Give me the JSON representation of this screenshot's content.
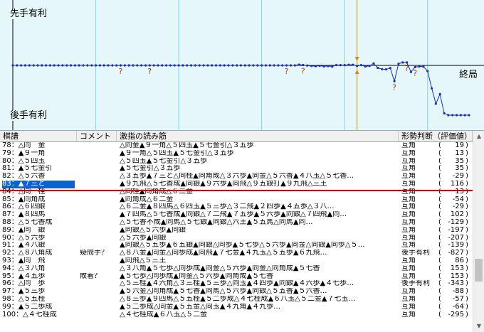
{
  "graph": {
    "top_label": "先手有利",
    "bottom_label": "後手有利",
    "end_label": "終局",
    "current_move": 83,
    "question_moves": [
      26,
      33,
      66,
      70,
      92,
      95,
      97
    ],
    "evaluations": [
      0,
      0,
      0,
      0,
      0,
      0,
      0,
      0,
      0,
      0,
      0,
      0,
      0,
      0,
      0,
      0,
      0,
      0,
      0,
      0,
      0,
      0,
      0,
      0,
      0,
      0,
      0,
      0,
      0,
      0,
      0,
      0,
      0,
      0,
      0,
      0,
      0,
      0,
      0,
      0,
      0,
      0,
      0,
      0,
      0,
      0,
      0,
      0,
      0,
      0,
      0,
      0,
      0,
      0,
      0,
      0,
      0,
      0,
      0,
      0,
      0,
      0,
      0,
      0,
      0,
      0,
      0,
      0,
      0,
      40,
      20,
      -10,
      -30,
      -40,
      -20,
      -50,
      -35,
      -60,
      19,
      13,
      13,
      35,
      35,
      -29,
      13,
      -54,
      -29,
      102,
      -129,
      -197,
      -207,
      -139,
      -827,
      86,
      153,
      153,
      -343,
      -88,
      -57,
      -64,
      -295,
      -1200,
      -2000,
      -1500,
      -2500,
      -2600,
      -2600,
      -2600,
      -2600,
      -2600,
      -2600
    ]
  },
  "table": {
    "headers": {
      "move": "棋譜",
      "comment": "コメント",
      "line": "激指の読み筋",
      "judge": "形勢判断（評価値）"
    },
    "rows": [
      {
        "move": "78：△同　金",
        "comment": "",
        "line": "△同金▲９一角△５四玉▲５七金引△３五歩",
        "judge": "互角",
        "value": "19"
      },
      {
        "move": "79：▲９一角",
        "comment": "",
        "line": "▲９一角△５四玉▲５七金引△３五歩",
        "judge": "互角",
        "value": "13"
      },
      {
        "move": "80：△５四玉",
        "comment": "",
        "line": "△５四玉▲５七金引△３五歩",
        "judge": "互角",
        "value": "35"
      },
      {
        "move": "81：▲５七金引",
        "comment": "",
        "line": "▲５七金引△３五歩",
        "judge": "互角",
        "value": "35"
      },
      {
        "move": "82：△５六香",
        "comment": "",
        "line": "△３五歩▲７三と△同桂▲同角成△３六歩▲同金△５六香▲４八玉△５七香…",
        "judge": "互角",
        "value": "-29"
      },
      {
        "move": "83：▲７三と",
        "comment": "",
        "line": "▲９九飛△５七香成▲同銀▲９六歩▲同飛△９五銀打▲９九飛△三王",
        "judge": "互角",
        "value": "116"
      },
      {
        "move": "84：△同　桂",
        "comment": "",
        "line": "△同桂▲同角成△６二金",
        "judge": "互角",
        "value": "13"
      },
      {
        "move": "85：▲同角成",
        "comment": "",
        "line": "▲同角成△６二金",
        "judge": "互角",
        "value": "-54"
      },
      {
        "move": "86：△６四銀",
        "comment": "",
        "line": "△６二金▲８四馬△６四玉▲５三歩△３二飛▲２四歩▲４五歩△３八…",
        "judge": "互角",
        "value": "-29"
      },
      {
        "move": "87：▲８四馬",
        "comment": "",
        "line": "▲７四馬△５七香成▲同銀△７二飛▲７五歩▲５六歩▲同銀△７四飛▲同…",
        "judge": "互角",
        "value": "102"
      },
      {
        "move": "88：△５七香成",
        "comment": "",
        "line": "△５七香不成▲同馬△５七銀▲同銀△六王▲５五馬△同馬▲同…",
        "judge": "互角",
        "value": "-129"
      },
      {
        "move": "89：▲同　銀",
        "comment": "",
        "line": "▲同銀△５六歩▲同銀",
        "judge": "互角",
        "value": "-197"
      },
      {
        "move": "90：△５六歩",
        "comment": "",
        "line": "△５六歩▲同銀",
        "judge": "互角",
        "value": "-207"
      },
      {
        "move": "91：▲４八銀",
        "comment": "",
        "line": "▲同銀△５五歩▲６五銀▲同銀△同歩▲５七歩△５六歩▲同金△同銀▲同歩△５…",
        "judge": "互角",
        "value": "-139"
      },
      {
        "move": "92：△８八角成",
        "comment": "疑問手？",
        "line": "△８八金▲同金△同歩成▲同飛▲７七金▲４九玉△５五歩▲６九飛…",
        "judge": "後手有利",
        "value": "-827"
      },
      {
        "move": "93：▲同　飛",
        "comment": "",
        "line": "▲同飛△５三王",
        "judge": "互角",
        "value": "86"
      },
      {
        "move": "94：△３八角",
        "comment": "",
        "line": "△３八角▲５七歩△同歩成▲同金△５六歩▲同金△同角成▲５七香",
        "judge": "互角",
        "value": "153"
      },
      {
        "move": "95：▲４五歩",
        "comment": "敗着？",
        "line": "▲５七歩△同歩成▲同金△５六歩▲同角成▲５七香",
        "judge": "互角",
        "value": "153"
      },
      {
        "move": "96：△同　歩",
        "comment": "",
        "line": "△５三桂▲４六角△３三桂▲５三歩△同玉▲４四歩▲同銀▲４六歩▲４七歩…",
        "judge": "後手有利",
        "value": "-343"
      },
      {
        "move": "97：▲５三歩",
        "comment": "",
        "line": "▲５六金△同角成▲５七香▲同馬△５六歩▲同銀△５五香▲５六香…",
        "judge": "互角",
        "value": "-88"
      },
      {
        "move": "98：△５五桂",
        "comment": "",
        "line": "△８三歩▲９四馬△５五桂▲５二歩成△４七桂成▲６八玉△５二金▲７七玉…",
        "judge": "互角",
        "value": "-57"
      },
      {
        "move": "99：▲５二歩成",
        "comment": "",
        "line": "▲５二歩成△同金▲５五金△同玉▲４九角▲４九歩…",
        "judge": "互角",
        "value": "-64"
      },
      {
        "move": "100：△４七桂成",
        "comment": "",
        "line": "△４七桂成▲６八玉△５二金",
        "judge": "互角",
        "value": "-295"
      }
    ]
  },
  "scroll": {
    "up_icon": "scroll-up-arrow-icon",
    "down_icon": "scroll-down-arrow-icon"
  }
}
